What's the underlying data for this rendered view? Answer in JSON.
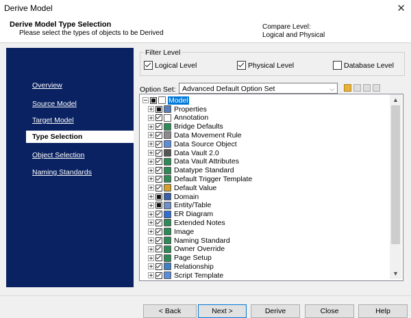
{
  "window": {
    "title": "Derive Model",
    "close_glyph": "✕"
  },
  "header": {
    "title": "Derive Model Type Selection",
    "subtitle": "Please select the types of objects to be Derived",
    "compare_label": "Compare Level:",
    "compare_value": "Logical and Physical"
  },
  "nav": {
    "items": [
      {
        "label": "Overview",
        "active": false
      },
      {
        "label": "Source Model",
        "active": false
      },
      {
        "label": "Target Model",
        "active": false
      },
      {
        "label": "Type Selection",
        "active": true
      },
      {
        "label": "Object Selection",
        "active": false
      },
      {
        "label": "Naming Standards",
        "active": false
      }
    ]
  },
  "filter": {
    "legend": "Filter Level",
    "options": [
      {
        "label": "Logical Level",
        "checked": true
      },
      {
        "label": "Physical Level",
        "checked": true
      },
      {
        "label": "Database Level",
        "checked": false
      }
    ]
  },
  "option_set": {
    "label": "Option Set:",
    "value": "Advanced Default Option Set"
  },
  "tree": {
    "root": {
      "label": "Model",
      "icon": "model-icon",
      "state": "partial"
    },
    "items": [
      {
        "label": "Properties",
        "state": "partial",
        "icon": "properties-icon",
        "icon_color": "#5a7fb8"
      },
      {
        "label": "Annotation",
        "state": "checked",
        "icon": "text-icon",
        "icon_color": "#ffffff"
      },
      {
        "label": "Bridge Defaults",
        "state": "checked",
        "icon": "bridge-icon",
        "icon_color": "#2e8b57"
      },
      {
        "label": "Data Movement Rule",
        "state": "checked",
        "icon": "rule-icon",
        "icon_color": "#8c8c8c"
      },
      {
        "label": "Data Source Object",
        "state": "checked",
        "icon": "datasource-icon",
        "icon_color": "#5b8dd9"
      },
      {
        "label": "Data Vault 2.0",
        "state": "checked",
        "icon": "vault-icon",
        "icon_color": "#555555"
      },
      {
        "label": "Data Vault Attributes",
        "state": "checked",
        "icon": "attributes-icon",
        "icon_color": "#2e8b57"
      },
      {
        "label": "Datatype Standard",
        "state": "checked",
        "icon": "datatype-icon",
        "icon_color": "#2e8b57"
      },
      {
        "label": "Default Trigger Template",
        "state": "checked",
        "icon": "trigger-icon",
        "icon_color": "#2e8b57"
      },
      {
        "label": "Default Value",
        "state": "checked",
        "icon": "value-icon",
        "icon_color": "#d4a02a"
      },
      {
        "label": "Domain",
        "state": "partial",
        "icon": "domain-icon",
        "icon_color": "#3a5fa8"
      },
      {
        "label": "Entity/Table",
        "state": "partial",
        "icon": "table-icon",
        "icon_color": "#6f8fc9"
      },
      {
        "label": "ER Diagram",
        "state": "checked",
        "icon": "diagram-icon",
        "icon_color": "#2f6fd0"
      },
      {
        "label": "Extended Notes",
        "state": "checked",
        "icon": "notes-icon",
        "icon_color": "#2e8b57"
      },
      {
        "label": "Image",
        "state": "checked",
        "icon": "image-icon",
        "icon_color": "#2e8b57"
      },
      {
        "label": "Naming Standard",
        "state": "checked",
        "icon": "naming-icon",
        "icon_color": "#2e8b57"
      },
      {
        "label": "Owner Override",
        "state": "checked",
        "icon": "owner-icon",
        "icon_color": "#2e8b57"
      },
      {
        "label": "Page Setup",
        "state": "checked",
        "icon": "pagesetup-icon",
        "icon_color": "#2e8b57"
      },
      {
        "label": "Relationship",
        "state": "checked",
        "icon": "relationship-icon",
        "icon_color": "#3f7fc6"
      },
      {
        "label": "Script Template",
        "state": "checked",
        "icon": "script-icon",
        "icon_color": "#5b8dd9"
      }
    ]
  },
  "buttons": {
    "back": "< Back",
    "next": "Next >",
    "derive": "Derive",
    "close": "Close",
    "help": "Help"
  }
}
